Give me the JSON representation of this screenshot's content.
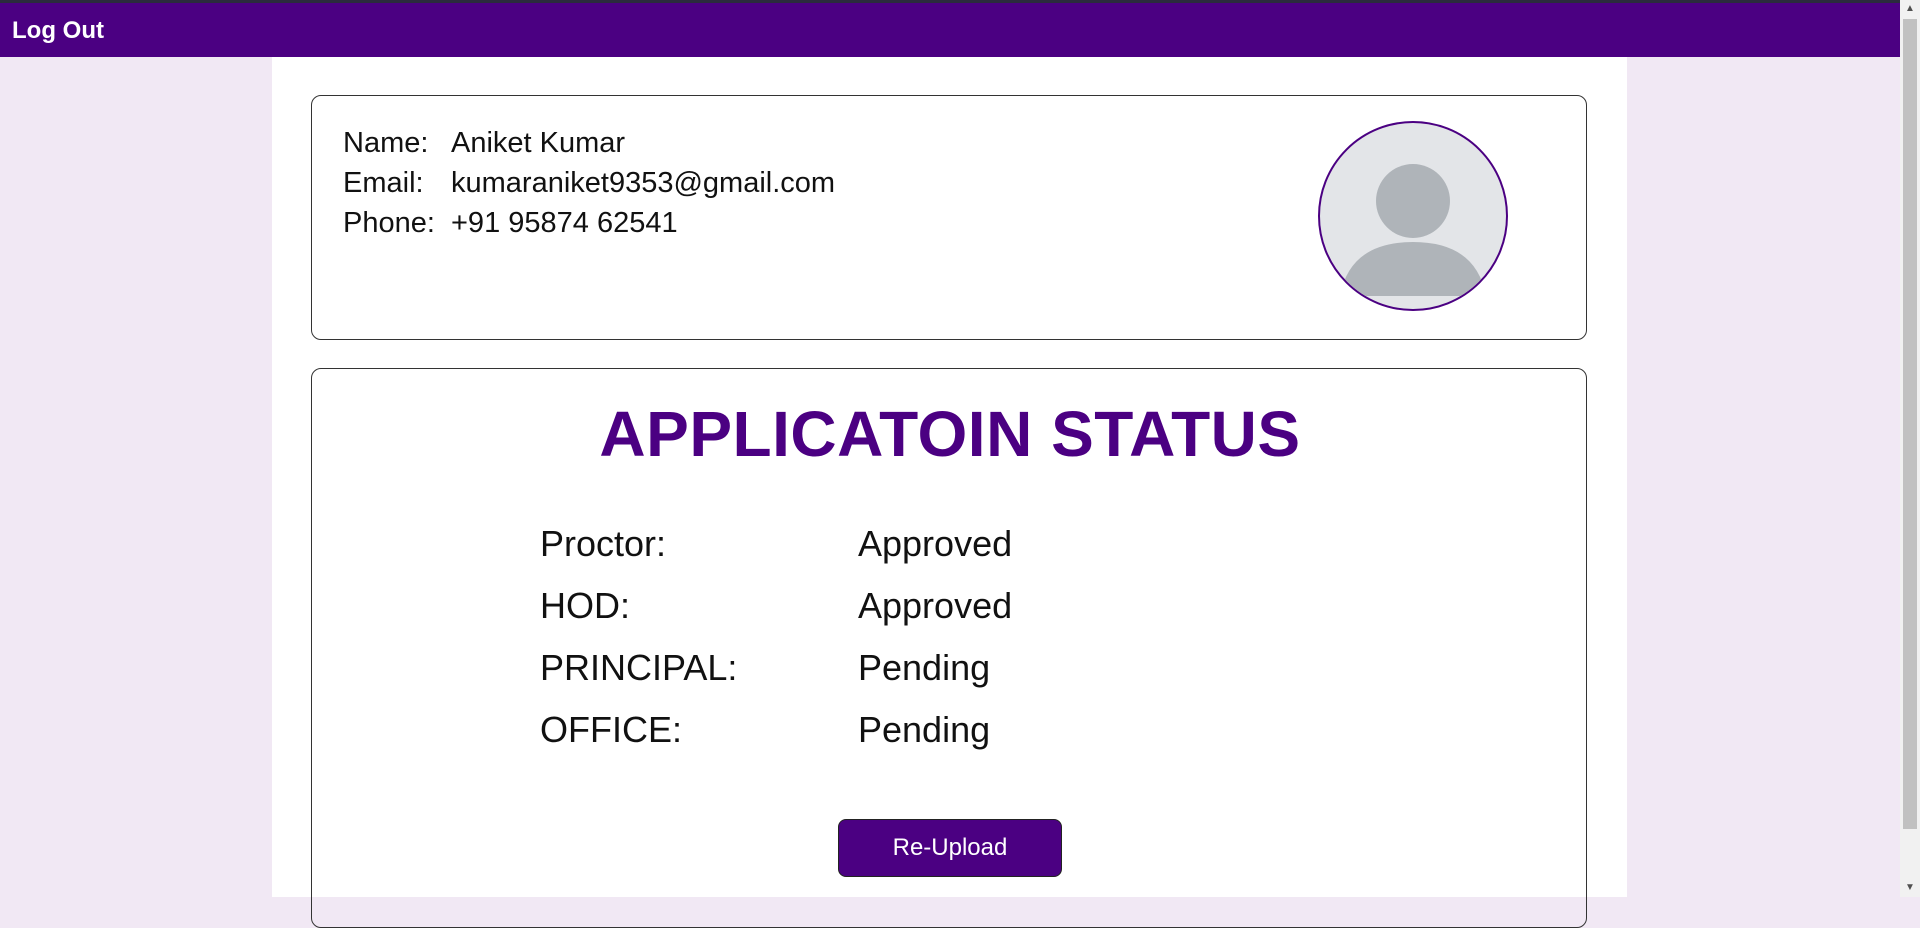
{
  "navbar": {
    "logout_label": "Log Out"
  },
  "profile": {
    "name_label": "Name:",
    "name_value": "Aniket Kumar",
    "email_label": "Email:",
    "email_value": "kumaraniket9353@gmail.com",
    "phone_label": "Phone:",
    "phone_value": "+91 95874 62541",
    "avatar_icon": "user-placeholder-icon"
  },
  "status": {
    "title": "APPLICATOIN STATUS",
    "rows": [
      {
        "role": "Proctor:",
        "state": "Approved"
      },
      {
        "role": "HOD:",
        "state": "Approved"
      },
      {
        "role": "PRINCIPAL:",
        "state": "Pending"
      },
      {
        "role": "OFFICE:",
        "state": "Pending"
      }
    ],
    "reupload_label": "Re-Upload"
  },
  "colors": {
    "brand": "#4b0082",
    "page_bg": "#f1e8f4",
    "avatar_bg": "#e3e5e8",
    "avatar_figure": "#afb4b9"
  }
}
